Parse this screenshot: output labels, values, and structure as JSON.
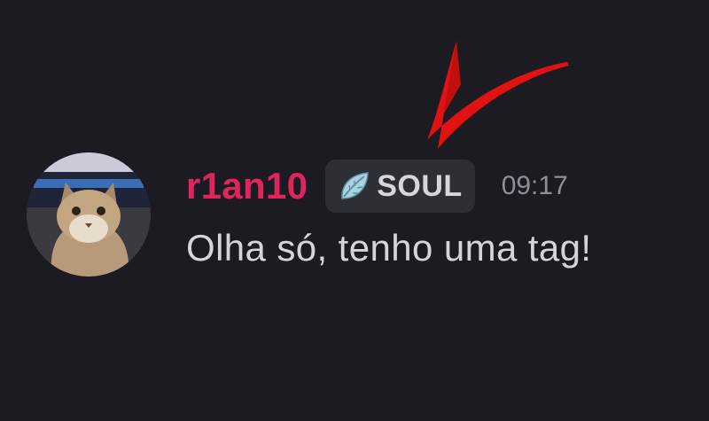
{
  "message": {
    "author": {
      "username": "r1an10",
      "name_color": "#e0245e",
      "avatar": "cat-avatar"
    },
    "tag": {
      "icon": "leaf-icon",
      "label": "SOUL"
    },
    "timestamp": "09:17",
    "content": "Olha só, tenho uma tag!"
  },
  "annotation": {
    "icon": "red-arrow-icon",
    "color": "#e01212"
  }
}
